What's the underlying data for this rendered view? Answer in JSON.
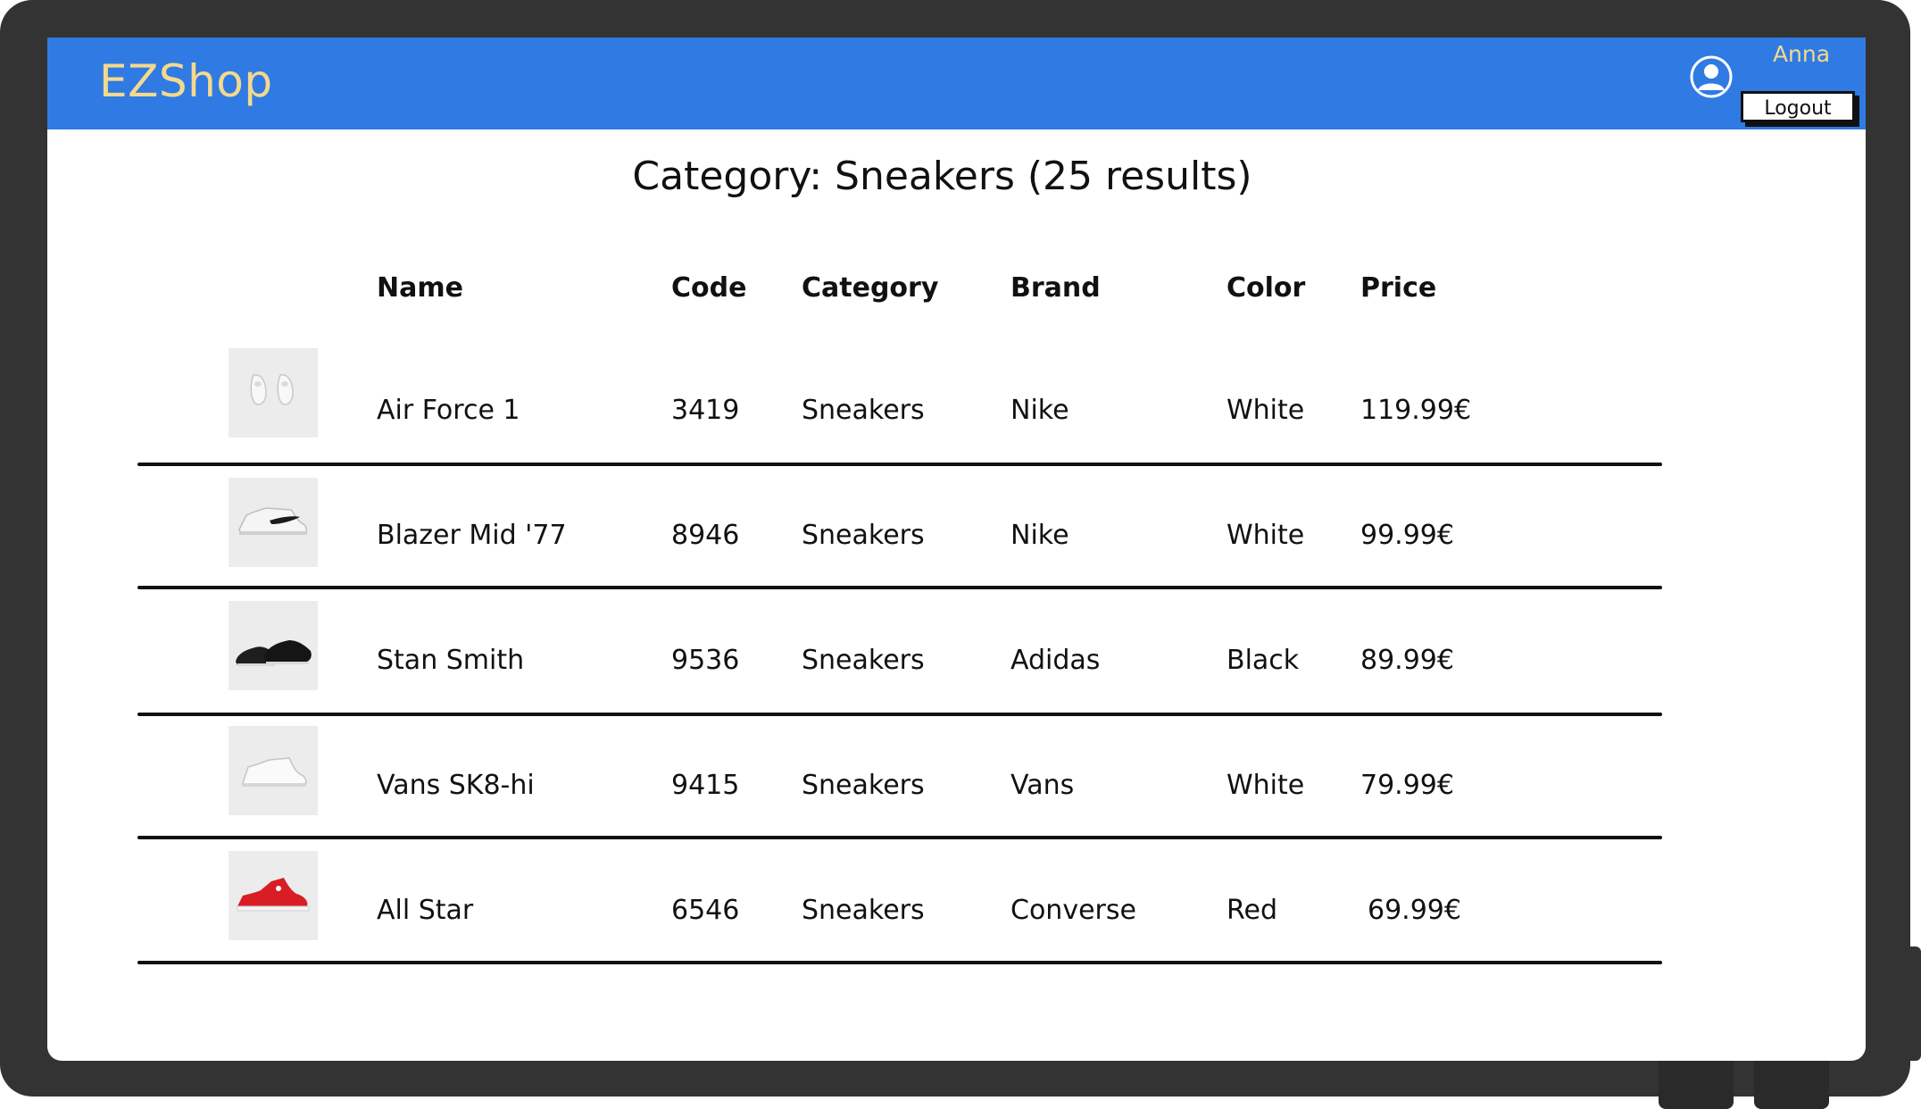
{
  "header": {
    "logo": "EZShop",
    "user_name": "Anna",
    "logout_label": "Logout"
  },
  "page": {
    "title": "Category: Sneakers (25 results)"
  },
  "table": {
    "columns": [
      "Name",
      "Code",
      "Category",
      "Brand",
      "Color",
      "Price"
    ],
    "rows": [
      {
        "name": "Air Force 1",
        "code": "3419",
        "category": "Sneakers",
        "brand": "Nike",
        "color": "White",
        "price": "119.99€",
        "image": "white-sneakers-pair"
      },
      {
        "name": "Blazer Mid '77",
        "code": "8946",
        "category": "Sneakers",
        "brand": "Nike",
        "color": "White",
        "price": "99.99€",
        "image": "white-high-top-black-swoosh"
      },
      {
        "name": "Stan Smith",
        "code": "9536",
        "category": "Sneakers",
        "brand": "Adidas",
        "color": "Black",
        "price": "89.99€",
        "image": "black-sneakers-pair"
      },
      {
        "name": "Vans SK8-hi",
        "code": "9415",
        "category": "Sneakers",
        "brand": "Vans",
        "color": "White",
        "price": "79.99€",
        "image": "white-high-top"
      },
      {
        "name": "All Star",
        "code": "6546",
        "category": "Sneakers",
        "brand": "Converse",
        "color": "Red",
        "price": "69.99€",
        "image": "red-high-top"
      }
    ]
  },
  "colors": {
    "header_bg": "#2f7be3",
    "logo": "#f4d98d",
    "frame": "#333333"
  }
}
